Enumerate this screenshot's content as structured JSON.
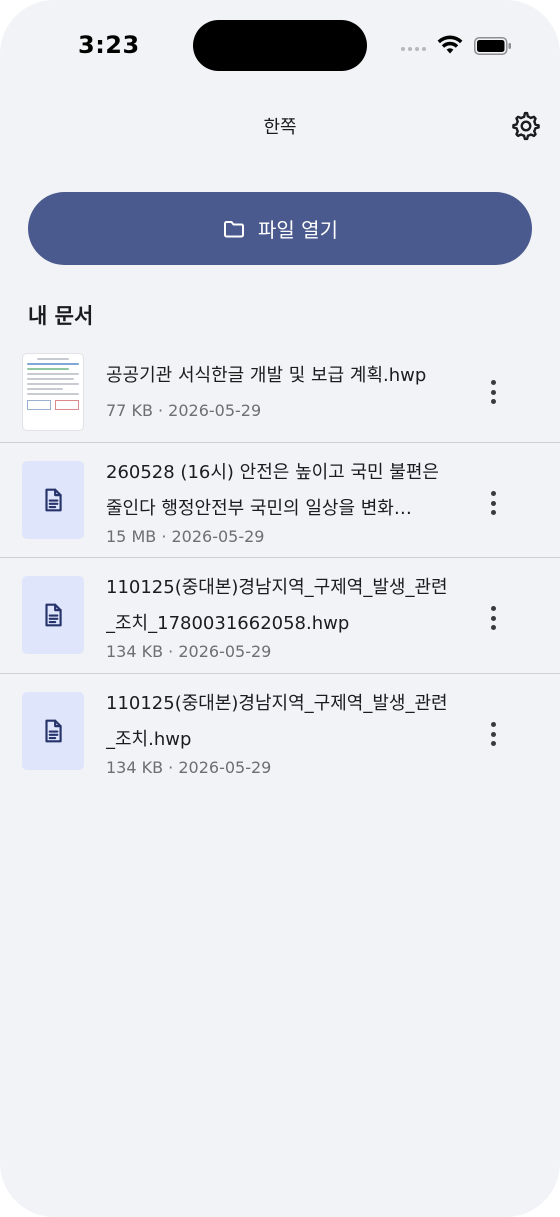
{
  "status_bar": {
    "time": "3:23"
  },
  "header": {
    "title": "한쪽",
    "settings_icon": "gear-icon"
  },
  "open_file": {
    "label": "파일 열기",
    "icon": "folder-icon"
  },
  "section_title": "내 문서",
  "colors": {
    "accent": "#4b5a8e",
    "background": "#f2f3f6",
    "file_tile": "#dfe5fa"
  },
  "documents": [
    {
      "name": "공공기관 서식한글 개발 및 보급 계획.hwp",
      "meta": "77 KB · 2026-05-29",
      "thumbnail": "page-preview"
    },
    {
      "name": "260528 (16시) 안전은 높이고 국민 불편은 줄인다 행정안전부 국민의 일상을 변화…",
      "meta": "15 MB · 2026-05-29",
      "thumbnail": "document-icon"
    },
    {
      "name": "110125(중대본)경남지역_구제역_발생_관련_조치_1780031662058.hwp",
      "meta": "134 KB · 2026-05-29",
      "thumbnail": "document-icon"
    },
    {
      "name": "110125(중대본)경남지역_구제역_발생_관련_조치.hwp",
      "meta": "134 KB · 2026-05-29",
      "thumbnail": "document-icon"
    }
  ]
}
